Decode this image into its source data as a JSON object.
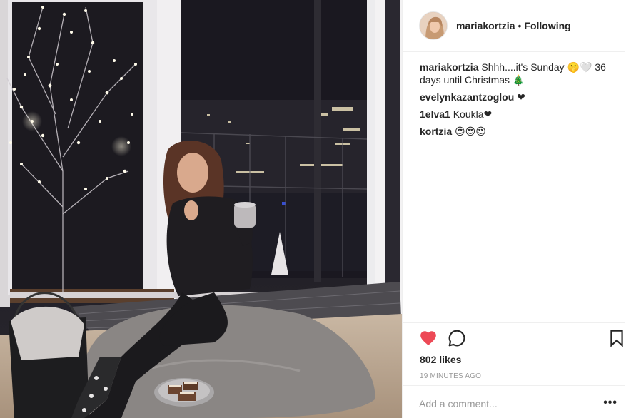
{
  "post": {
    "image_alt": "Woman sitting on a blanket by a window with a cup and cookies",
    "author": "mariakortzia",
    "separator": "•",
    "follow_status": "Following"
  },
  "comments": [
    {
      "user": "mariakortzia",
      "text": "Shhh....it's Sunday 🤫🤍 36 days until Christmas 🎄"
    },
    {
      "user": "evelynkazantzoglou",
      "text": "❤"
    },
    {
      "user": "1elva1",
      "text": "Koukla❤"
    },
    {
      "user": "kortzia",
      "text": "😍😍😍"
    }
  ],
  "actions": {
    "likes_label": "802 likes",
    "timestamp": "19 MINUTES AGO",
    "like_color": "#ed4956"
  },
  "comment_input": {
    "placeholder": "Add a comment...",
    "more_label": "•••"
  }
}
